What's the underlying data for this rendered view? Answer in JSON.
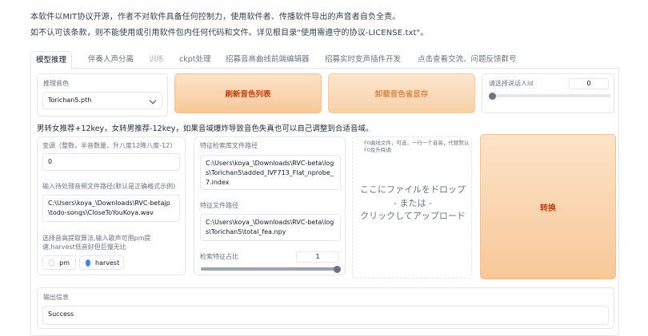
{
  "notice": {
    "line1": "本软件以MIT协议开源，作者不对软件具备任何控制力，使用软件者、传播软件导出的声音者自负全责。",
    "line2": "如不认可该条款，则不能使用或引用软件包内任何代码和文件。详见根目录\"使用需遵守的协议-LICENSE.txt\"。"
  },
  "tabs": [
    {
      "label": "模型推理",
      "state": "active"
    },
    {
      "label": "伴奏人声分离",
      "state": "normal"
    },
    {
      "label": "训练",
      "state": "disabled"
    },
    {
      "label": "ckpt处理",
      "state": "normal"
    },
    {
      "label": "招募音高曲线前端编辑器",
      "state": "normal"
    },
    {
      "label": "招募实时变声插件开发",
      "state": "normal"
    },
    {
      "label": "点击查看交流、问题反馈群号",
      "state": "normal"
    }
  ],
  "voice": {
    "label": "推理音色",
    "selected": "Torichan5.pth"
  },
  "buttons": {
    "refresh": "刷新音色列表",
    "unload": "卸载音色省显存",
    "convert": "转换"
  },
  "speaker": {
    "label": "请选择说话人id",
    "value": "0",
    "fraction": 0.0
  },
  "tip": "男转女推荐+12key，女转男推荐-12key，如果音域爆炸导致音色失真也可以自己调整到合适音域。",
  "transpose": {
    "label": "变调（整数，半音数量，升八度12降八度-12）",
    "value": "0"
  },
  "input_path": {
    "label": "输入待处理音频文件路径(默认是正确格式示例)",
    "value": "C:\\Users\\koya_\\Downloads\\RVC-betajp\\todo-songs\\CloseToYouKoya.wav"
  },
  "pitch_method": {
    "label": "选择音高提取算法,输入歌声可用pm提速,harvest低音好但巨慢无比",
    "options": [
      {
        "label": "pm",
        "checked": false
      },
      {
        "label": "harvest",
        "checked": true
      }
    ]
  },
  "feature_index": {
    "label": "特征检索库文件路径",
    "value": "C:\\Users\\koya_\\Downloads\\RVC-beta\\logs\\Torichan5\\added_IVF713_Flat_nprobe_7.index"
  },
  "feature_file": {
    "label": "特征文件路径",
    "value": "C:\\Users\\koya_\\Downloads\\RVC-beta\\logs\\Torichan5\\total_fea.npy"
  },
  "feature_ratio": {
    "label": "检索特征占比",
    "value": "1",
    "fraction": 1.0
  },
  "f0_upload": {
    "label": "F0曲线文件，可选，一行一个音高，代替默认F0及升降调",
    "drop_line1": "ここにファイルをドロップ",
    "drop_line2": "- または -",
    "drop_line3": "クリックしてアップロード"
  },
  "output": {
    "label": "输出信息",
    "value": "Success"
  }
}
